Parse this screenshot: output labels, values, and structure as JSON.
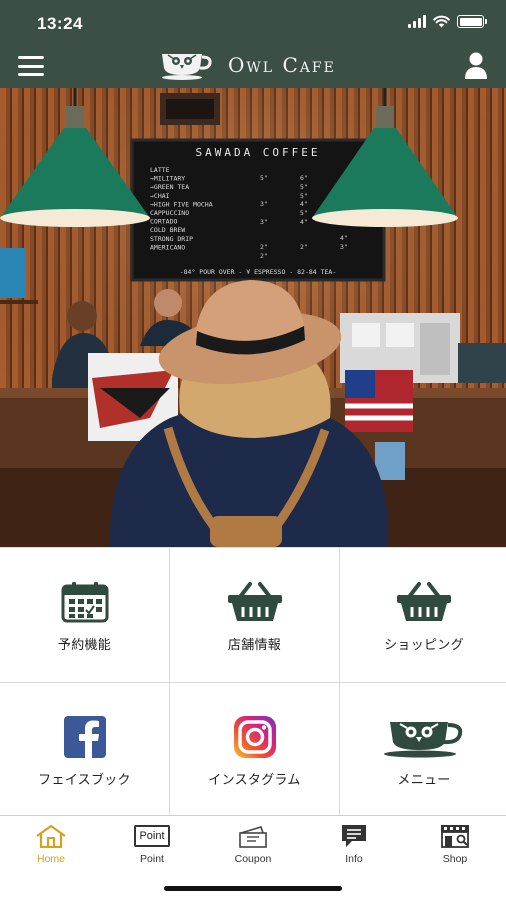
{
  "status_bar": {
    "time": "13:24"
  },
  "header": {
    "brand_name": "Owl Cafe",
    "menu_icon": "hamburger-menu-icon",
    "account_icon": "user-icon"
  },
  "hero": {
    "description_icon": "cafe-photo",
    "chalkboard_title": "SAWADA COFFEE",
    "chalkboard_items": [
      "LATTE",
      "→MILITARY",
      "→GREEN TEA",
      "→CHAI",
      "→HIGH FIVE MOCHA",
      "CAPPUCCINO",
      "CORTADO",
      "COLD BREW",
      "STRONG DRIP",
      "AMERICANO"
    ],
    "chalkboard_footer": "-84° POUR OVER - ¥ ESPRESSO - 82-84 TEA-"
  },
  "tiles": [
    {
      "label": "予約機能",
      "icon": "calendar-icon"
    },
    {
      "label": "店舗情報",
      "icon": "basket-icon"
    },
    {
      "label": "ショッピング",
      "icon": "shopping-basket-icon"
    },
    {
      "label": "フェイスブック",
      "icon": "facebook-icon"
    },
    {
      "label": "インスタグラム",
      "icon": "instagram-icon"
    },
    {
      "label": "メニュー",
      "icon": "cafe-cup-icon"
    }
  ],
  "tabbar": {
    "items": [
      {
        "label": "Home",
        "icon": "home-icon",
        "active": true
      },
      {
        "label": "Point",
        "icon": "point-card-icon",
        "badge_text": "Point"
      },
      {
        "label": "Coupon",
        "icon": "coupon-icon"
      },
      {
        "label": "Info",
        "icon": "info-message-icon"
      },
      {
        "label": "Shop",
        "icon": "shop-icon"
      }
    ]
  },
  "colors": {
    "header_bg": "#3c4f45",
    "icon_green": "#2f4a3e",
    "active_tab": "#d7a11a",
    "facebook_blue": "#3b5998"
  }
}
